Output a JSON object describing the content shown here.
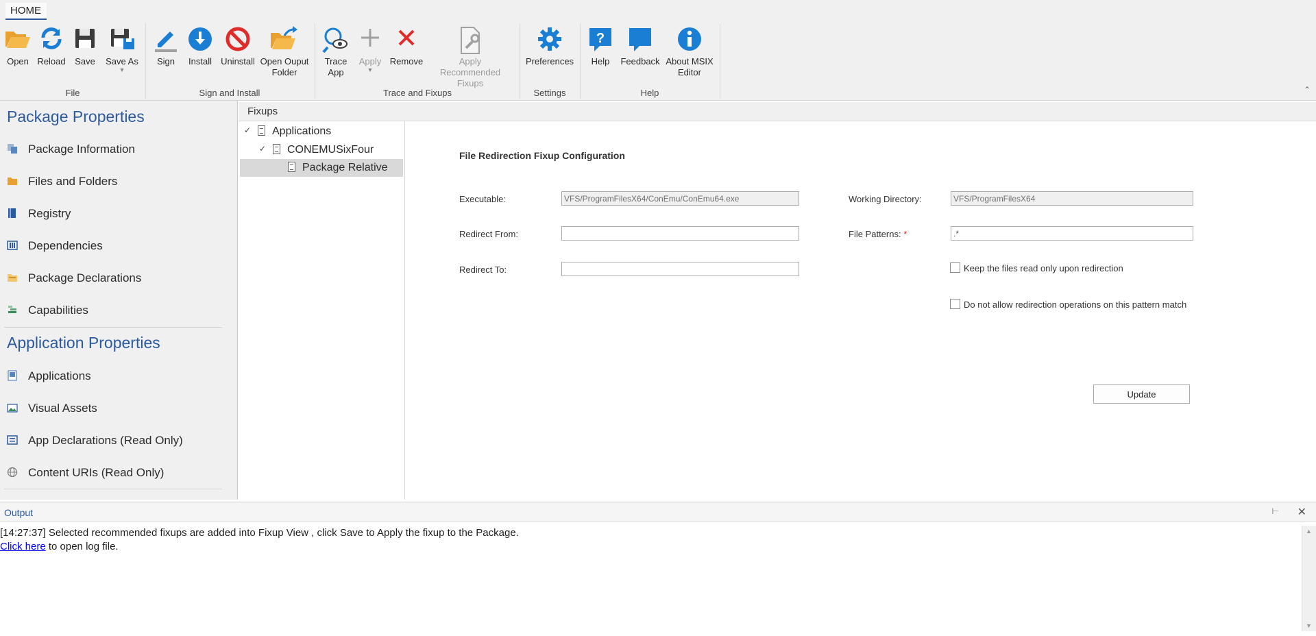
{
  "ribbon": {
    "tab": "HOME",
    "groups": {
      "file": "File",
      "sign_install": "Sign and Install",
      "trace_fixups": "Trace and Fixups",
      "settings": "Settings",
      "help": "Help"
    },
    "buttons": {
      "open": "Open",
      "reload": "Reload",
      "save": "Save",
      "save_as": "Save As",
      "sign": "Sign",
      "install": "Install",
      "uninstall": "Uninstall",
      "open_output_l1": "Open Ouput",
      "open_output_l2": "Folder",
      "trace_l1": "Trace",
      "trace_l2": "App",
      "apply": "Apply",
      "remove": "Remove",
      "apply_rec_l1": "Apply Recommended",
      "apply_rec_l2": "Fixups",
      "preferences": "Preferences",
      "help": "Help",
      "feedback": "Feedback",
      "about_l1": "About MSIX",
      "about_l2": "Editor"
    },
    "colors": {
      "blue": "#1a7fd4",
      "red": "#e02b2b",
      "orange": "#f0a030",
      "dark": "#3c3c3c",
      "gray": "#a0a0a0"
    }
  },
  "left_pane": {
    "package_title": "Package Properties",
    "package_items": [
      {
        "label": "Package Information",
        "icon": "package-info-icon"
      },
      {
        "label": "Files and Folders",
        "icon": "folder-icon"
      },
      {
        "label": "Registry",
        "icon": "registry-icon"
      },
      {
        "label": "Dependencies",
        "icon": "dependencies-icon"
      },
      {
        "label": "Package Declarations",
        "icon": "declarations-icon"
      },
      {
        "label": "Capabilities",
        "icon": "capabilities-icon"
      }
    ],
    "application_title": "Application Properties",
    "application_items": [
      {
        "label": "Applications",
        "icon": "applications-icon"
      },
      {
        "label": "Visual Assets",
        "icon": "visual-assets-icon"
      },
      {
        "label": "App Declarations (Read Only)",
        "icon": "app-declarations-icon"
      },
      {
        "label": "Content URIs (Read Only)",
        "icon": "globe-icon"
      }
    ]
  },
  "fixups": {
    "header": "Fixups",
    "tree": {
      "root": "Applications",
      "child": "CONEMUSixFour",
      "leaf": "Package Relative"
    }
  },
  "form": {
    "title": "File Redirection Fixup Configuration",
    "executable_label": "Executable:",
    "executable_value": "VFS/ProgramFilesX64/ConEmu/ConEmu64.exe",
    "working_dir_label": "Working Directory:",
    "working_dir_value": "VFS/ProgramFilesX64",
    "redirect_from_label": "Redirect From:",
    "redirect_from_value": "",
    "file_patterns_label": "File Patterns:",
    "required_mark": "*",
    "file_patterns_value": ".*",
    "redirect_to_label": "Redirect To:",
    "redirect_to_value": "",
    "keep_readonly_label": "Keep the files read only upon redirection",
    "keep_readonly_checked": false,
    "disallow_label": "Do not allow redirection operations on this pattern match",
    "disallow_checked": false,
    "update_label": "Update"
  },
  "output": {
    "title": "Output",
    "line1": "[14:27:37] Selected recommended fixups are added into Fixup View , click Save to Apply the fixup to the Package.",
    "link_text": "Click here",
    "line2_suffix": " to open log file."
  }
}
